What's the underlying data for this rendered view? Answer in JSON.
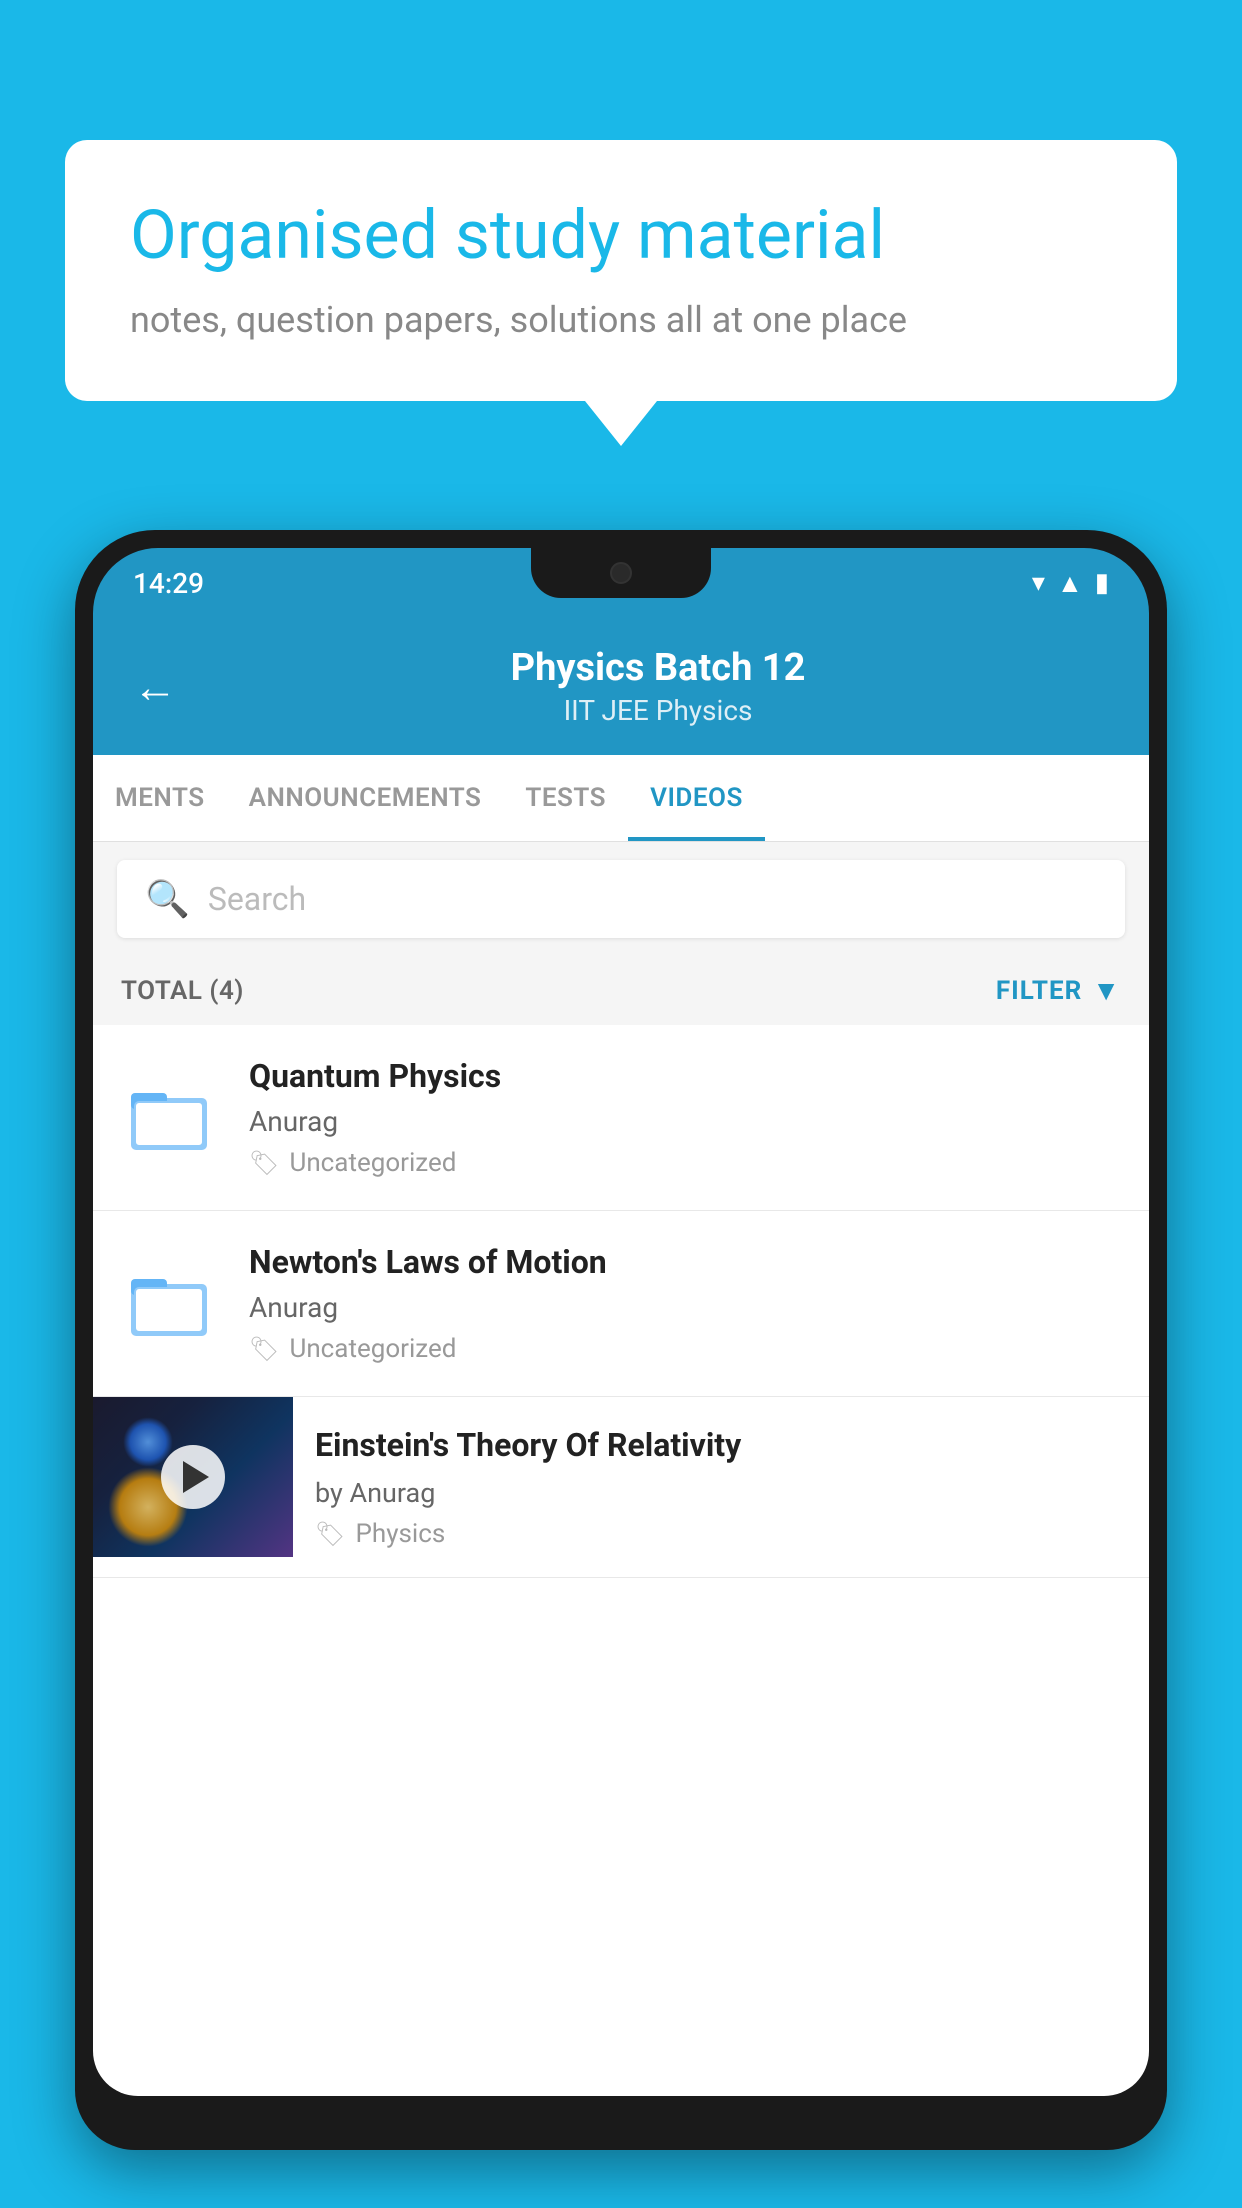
{
  "background_color": "#1ab8e8",
  "speech_bubble": {
    "title": "Organised study material",
    "subtitle": "notes, question papers, solutions all at one place"
  },
  "phone": {
    "status_bar": {
      "time": "14:29"
    },
    "header": {
      "title": "Physics Batch 12",
      "subtitle": "IIT JEE    Physics",
      "back_label": "←"
    },
    "tabs": [
      {
        "label": "MENTS",
        "active": false
      },
      {
        "label": "ANNOUNCEMENTS",
        "active": false
      },
      {
        "label": "TESTS",
        "active": false
      },
      {
        "label": "VIDEOS",
        "active": true
      }
    ],
    "search": {
      "placeholder": "Search"
    },
    "filter_bar": {
      "total_label": "TOTAL (4)",
      "filter_label": "FILTER"
    },
    "videos": [
      {
        "id": 1,
        "title": "Quantum Physics",
        "author": "Anurag",
        "tag": "Uncategorized",
        "has_thumbnail": false
      },
      {
        "id": 2,
        "title": "Newton's Laws of Motion",
        "author": "Anurag",
        "tag": "Uncategorized",
        "has_thumbnail": false
      },
      {
        "id": 3,
        "title": "Einstein's Theory Of Relativity",
        "author": "by Anurag",
        "tag": "Physics",
        "has_thumbnail": true
      }
    ]
  }
}
